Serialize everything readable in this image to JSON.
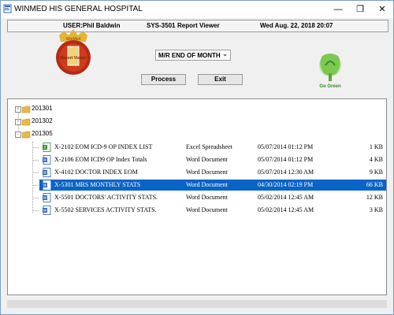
{
  "window": {
    "title": "WINMED HIS GENERAL HOSPITAL",
    "controls": {
      "minimize": "—",
      "maximize": "❐",
      "close": "✕"
    }
  },
  "infobar": {
    "user": "USER:Phil Baldwin",
    "system": "SYS-3501",
    "module": "Report Viewer",
    "datetime": "Wed Aug. 22, 2018 20:07"
  },
  "logos": {
    "left": {
      "text_top": "WinMed",
      "text_bottom": "Report Viewer"
    },
    "right": {
      "text": "Go Green"
    }
  },
  "report_select": {
    "selected": "M/R END OF MONTH"
  },
  "buttons": {
    "process": "Process",
    "exit": "Exit"
  },
  "tree": {
    "folders": [
      {
        "label": "201301",
        "expanded": false
      },
      {
        "label": "201302",
        "expanded": false
      },
      {
        "label": "201305",
        "expanded": true
      }
    ],
    "files": [
      {
        "name": "X-2102 EOM ICD-9 OP INDEX LIST",
        "type": "Excel Spreadsheet",
        "date": "05/07/2014 01:12 PM",
        "size": "1 KB",
        "icon": "excel-icon",
        "selected": false
      },
      {
        "name": "X-2106 EOM ICD9 OP Index Totals",
        "type": "Word Document",
        "date": "05/07/2014 01:12 PM",
        "size": "4 KB",
        "icon": "word-icon",
        "selected": false
      },
      {
        "name": "X-4102 DOCTOR INDEX EOM",
        "type": "Word Document",
        "date": "05/07/2014 12:30 AM",
        "size": "9 KB",
        "icon": "word-icon",
        "selected": false
      },
      {
        "name": "X-5301 MRS MONTHLY STATS",
        "type": "Word Document",
        "date": "04/30/2014 02:19 PM",
        "size": "66 KB",
        "icon": "word-icon",
        "selected": true
      },
      {
        "name": "X-5501 DOCTORS' ACTIVITY STATS.",
        "type": "Word Document",
        "date": "05/02/2014 12:45 AM",
        "size": "12 KB",
        "icon": "word-icon",
        "selected": false
      },
      {
        "name": "X-5502 SERVICES ACTIVITY STATS.",
        "type": "Word Document",
        "date": "05/02/2014 12:45 AM",
        "size": "3 KB",
        "icon": "word-icon",
        "selected": false
      }
    ]
  },
  "colors": {
    "selection": "#0a64c8",
    "folder": "#e8b84a",
    "excel": "#2e8b3a",
    "word": "#2b5fb0"
  }
}
